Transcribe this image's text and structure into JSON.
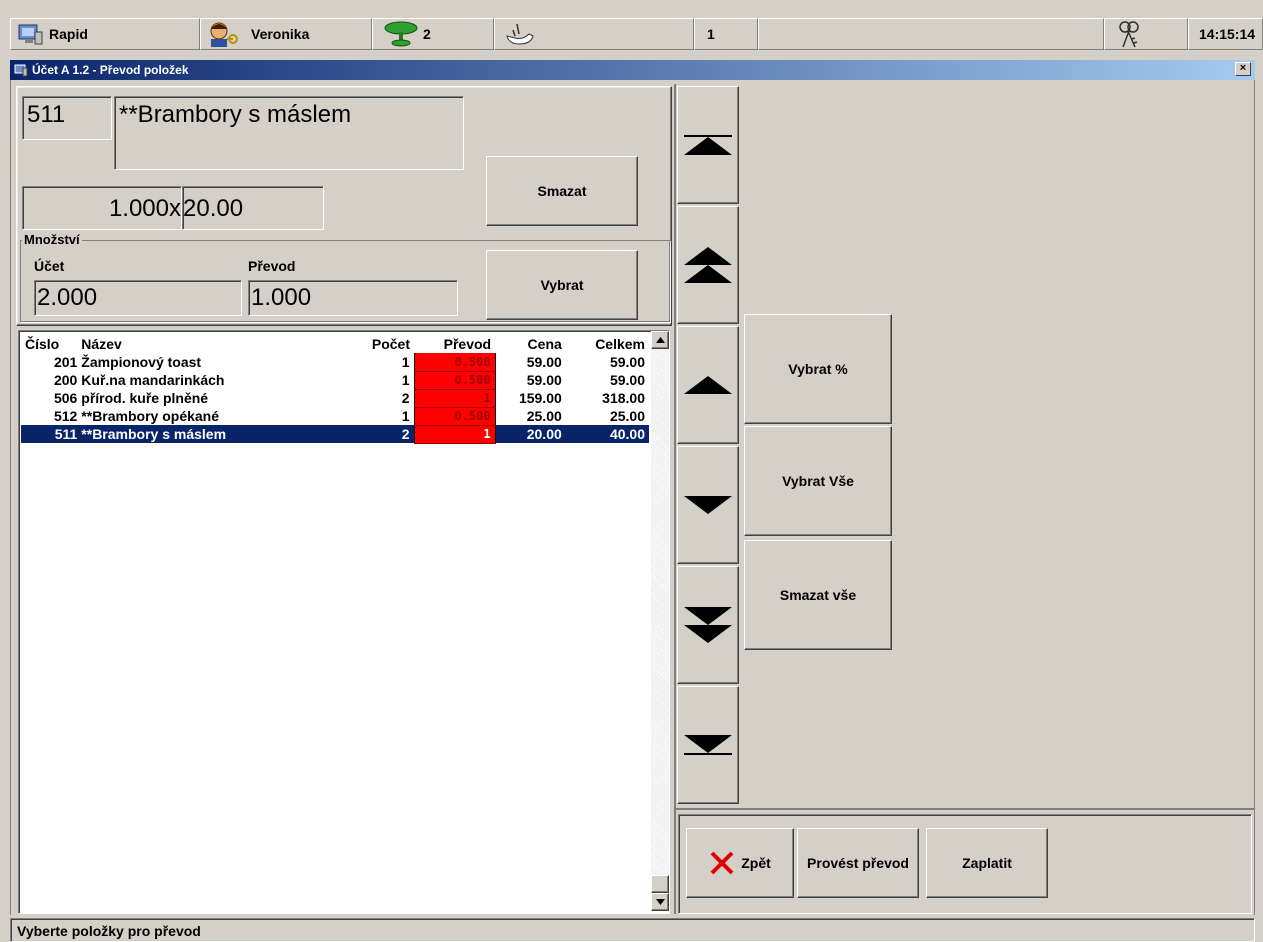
{
  "taskbar": {
    "app_label": "Rapid",
    "user_label": "Veronika",
    "tables_count": "2",
    "page_number": "1",
    "clock": "14:15:14"
  },
  "window": {
    "title": "Účet A 1.2 - Převod položek",
    "close_glyph": "×"
  },
  "item": {
    "code": "511",
    "name": "**Brambory s máslem",
    "qty_price_left": "1.000x",
    "qty_price_right": "20.00"
  },
  "buttons": {
    "smazat": "Smazat",
    "vybrat": "Vybrat",
    "vybrat_pct": "Vybrat %",
    "vybrat_vse": "Vybrat Vše",
    "smazat_vse": "Smazat vše",
    "zpet": "Zpět",
    "provest_prevod": "Provést převod",
    "zaplatit": "Zaplatit"
  },
  "mnozstvi": {
    "group_label": "Množství",
    "ucet_label": "Účet",
    "prevod_label": "Převod",
    "ucet_value": "2.000",
    "prevod_value": "1.000"
  },
  "table": {
    "headers": {
      "cislo": "Číslo",
      "nazev": "Název",
      "pocet": "Počet",
      "prevod": "Převod",
      "cena": "Cena",
      "celkem": "Celkem"
    },
    "rows": [
      {
        "cislo": "201",
        "nazev": "Žampionový toast",
        "pocet": "1",
        "prevod": "0.500",
        "cena": "59.00",
        "celkem": "59.00"
      },
      {
        "cislo": "200",
        "nazev": "Kuř.na mandarinkách",
        "pocet": "1",
        "prevod": "0.500",
        "cena": "59.00",
        "celkem": "59.00"
      },
      {
        "cislo": "506",
        "nazev": "přírod. kuře plněné",
        "pocet": "2",
        "prevod": "1",
        "cena": "159.00",
        "celkem": "318.00"
      },
      {
        "cislo": "512",
        "nazev": "**Brambory opékané",
        "pocet": "1",
        "prevod": "0.500",
        "cena": "25.00",
        "celkem": "25.00"
      },
      {
        "cislo": "511",
        "nazev": "**Brambory s máslem",
        "pocet": "2",
        "prevod": "1",
        "cena": "20.00",
        "celkem": "40.00"
      }
    ],
    "selected_index": 4
  },
  "status": {
    "message": "Vyberte položky pro převod"
  },
  "colors": {
    "selection": "#0a246a",
    "transfer_cell": "#ff0000",
    "close_x": "#e00000"
  }
}
